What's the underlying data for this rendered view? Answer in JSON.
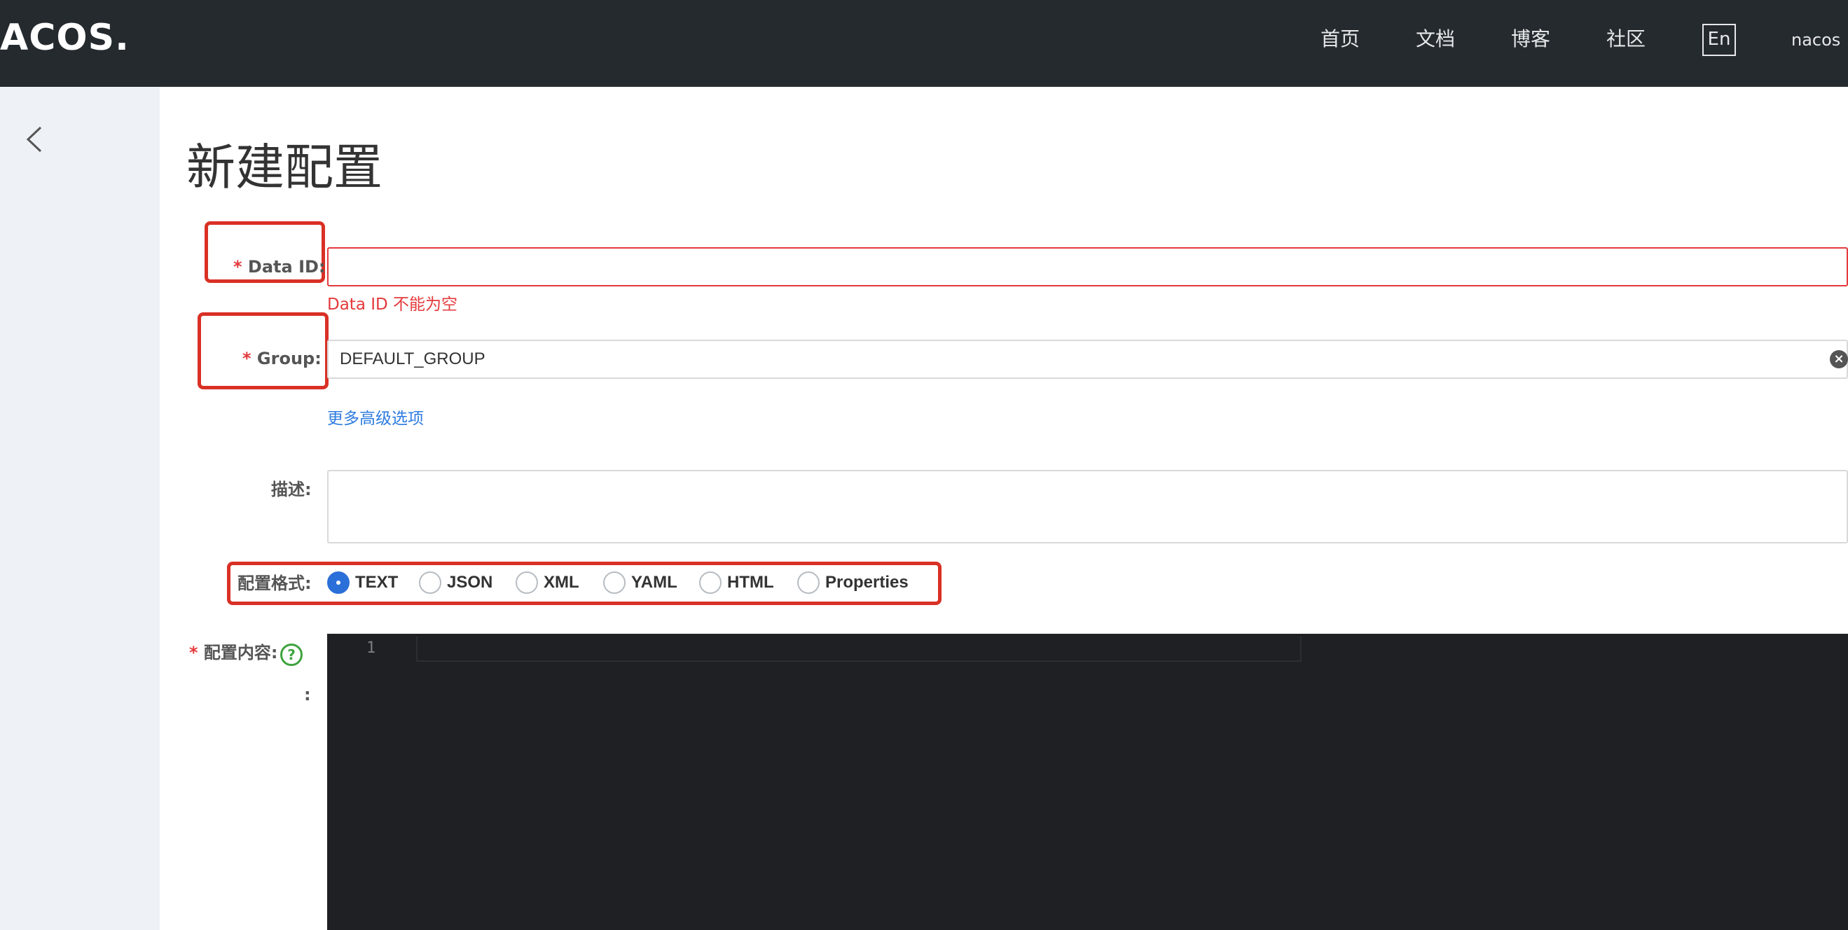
{
  "header": {
    "logo_text": "ACOS.",
    "nav": [
      "首页",
      "文档",
      "博客",
      "社区"
    ],
    "lang_button": "En",
    "user": "nacos"
  },
  "page": {
    "title": "新建配置"
  },
  "form": {
    "data_id": {
      "required_mark": "*",
      "label": "Data ID:",
      "value": "",
      "error": "Data ID 不能为空"
    },
    "group": {
      "required_mark": "*",
      "label": "Group:",
      "value": "DEFAULT_GROUP"
    },
    "advanced_link": "更多高级选项",
    "description": {
      "label": "描述:",
      "value": ""
    },
    "format": {
      "label": "配置格式:",
      "options": [
        "TEXT",
        "JSON",
        "XML",
        "YAML",
        "HTML",
        "Properties"
      ],
      "selected": "TEXT"
    },
    "content": {
      "required_mark": "*",
      "label": "配置内容:",
      "help_icon": "?",
      "colon": ":",
      "line_number": "1"
    }
  },
  "colors": {
    "topbar": "#252a2f",
    "sidebar": "#eef1f5",
    "annotation": "#d93025",
    "error": "#e4393c",
    "link": "#2e7ce0",
    "radio_checked": "#2b6fd8",
    "editor_bg": "#1e2023"
  },
  "icons": {
    "back": "chevron-left-icon",
    "clear": "clear-icon",
    "help": "question-circle-icon"
  }
}
